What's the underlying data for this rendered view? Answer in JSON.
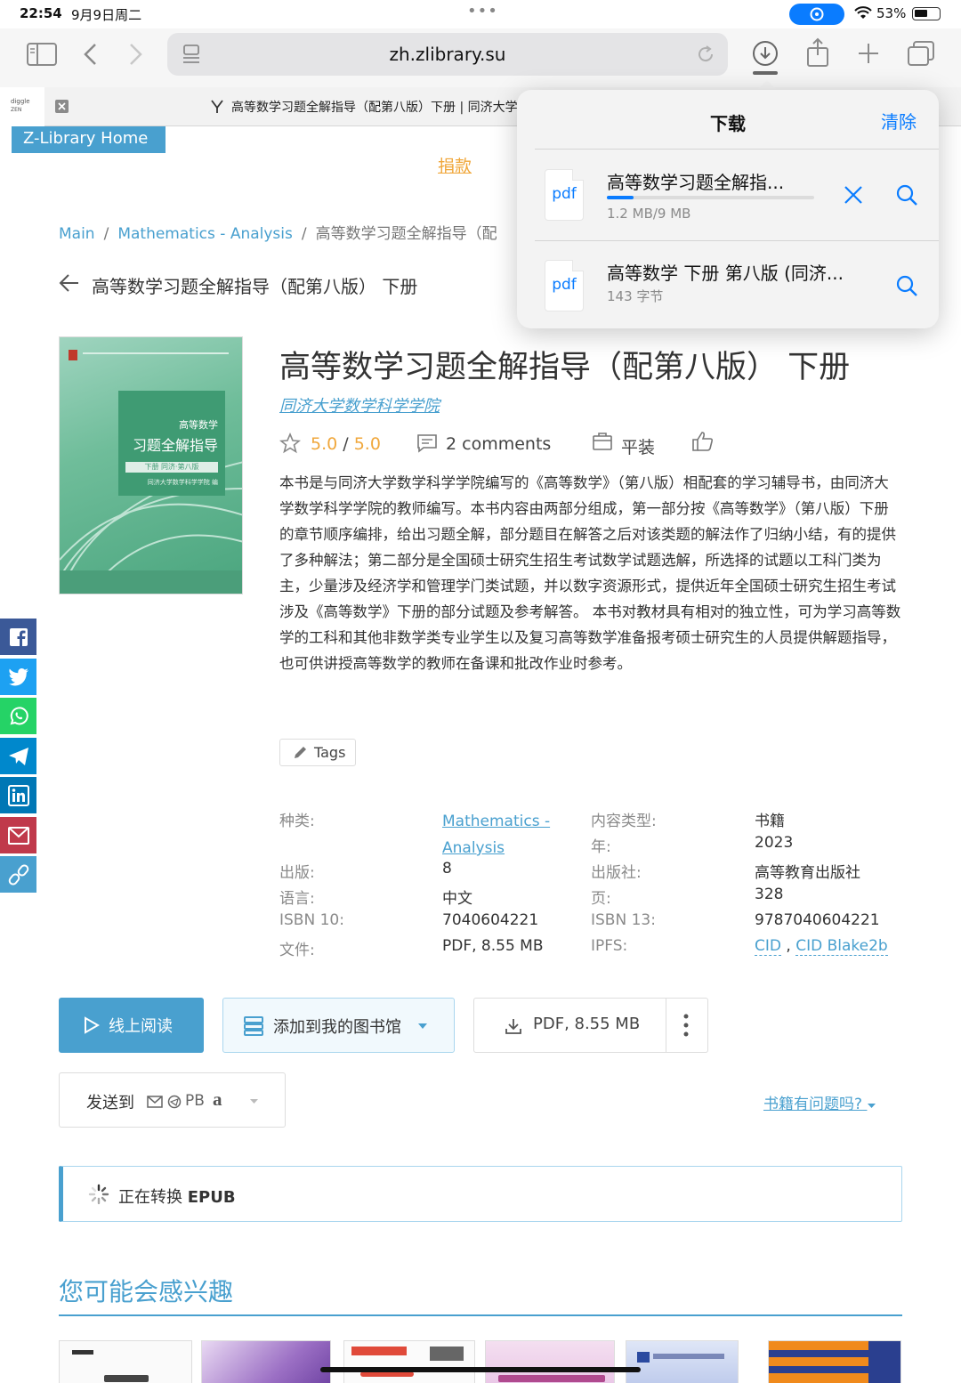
{
  "status_bar": {
    "time": "22:54",
    "date": "9月9日周二",
    "battery": "53%"
  },
  "browser": {
    "url": "zh.zlibrary.su",
    "tab_title": "高等数学习题全解指导（配第八版）下册 | 同济大学数学..."
  },
  "page": {
    "home_link": "Z-Library Home",
    "donate": "捐款",
    "breadcrumb": {
      "main": "Main",
      "category": "Mathematics - Analysis",
      "current": "高等数学习题全解指导（配"
    },
    "back_title": "高等数学习题全解指导（配第八版） 下册"
  },
  "book": {
    "title": "高等数学习题全解指导（配第八版） 下册",
    "author": "同济大学数学科学学院",
    "rating": "5.0",
    "rating_max": "5.0",
    "comments": "2 comments",
    "binding": "平装",
    "description": "本书是与同济大学数学科学学院编写的《高等数学》（第八版）相配套的学习辅导书，由同济大学数学科学学院的教师编写。本书内容由两部分组成，第一部分按《高等数学》（第八版）下册的章节顺序编排，给出习题全解，部分题目在解答之后对该类题的解法作了归纳小结，有的提供了多种解法；第二部分是全国硕士研究生招生考试数学试题选解，所选择的试题以工科门类为主，少量涉及经济学和管理学门类试题，并以数字资源形式，提供近年全国硕士研究生招生考试涉及《高等数学》下册的部分试题及参考解答。 本书对教材具有相对的独立性，可为学习高等数学的工科和其他非数学类专业学生以及复习高等数学准备报考硕士研究生的人员提供解题指导，也可供讲授高等数学的教师在备课和批改作业时参考。",
    "tags_label": "Tags",
    "cover": {
      "line1": "高等数学",
      "line2": "习题全解指导",
      "line3": "下册 同济·第八版",
      "line4": "同济大学数学科学学院 编"
    }
  },
  "details": {
    "category_label": "种类:",
    "category_value": "Mathematics - Analysis",
    "content_type_label": "内容类型:",
    "content_type_value": "书籍",
    "year_label": "年:",
    "year_value": "2023",
    "edition_label": "出版:",
    "edition_value": "8",
    "publisher_label": "出版社:",
    "publisher_value": "高等教育出版社",
    "language_label": "语言:",
    "language_value": "中文",
    "pages_label": "页:",
    "pages_value": "328",
    "isbn10_label": "ISBN 10:",
    "isbn10_value": "7040604221",
    "isbn13_label": "ISBN 13:",
    "isbn13_value": "9787040604221",
    "file_label": "文件:",
    "file_value": "PDF, 8.55 MB",
    "ipfs_label": "IPFS:",
    "ipfs_cid": "CID",
    "ipfs_sep": ",",
    "ipfs_blake": "CID Blake2b"
  },
  "actions": {
    "read_online": "线上阅读",
    "add_library": "添加到我的图书馆",
    "download": "PDF, 8.55 MB",
    "send_to": "发送到",
    "send_pb": "PB",
    "send_amazon": "a",
    "issue": "书籍有问题吗?"
  },
  "converting": {
    "prefix": "正在转换",
    "format": "EPUB"
  },
  "interest_title": "您可能会感兴趣",
  "downloads_popover": {
    "title": "下载",
    "clear": "清除",
    "items": [
      {
        "icon_label": "pdf",
        "name": "高等数学习题全解指...",
        "progress_text": "1.2 MB/9 MB",
        "progress": 0.13
      },
      {
        "icon_label": "pdf",
        "name": "高等数学 下册 第八版 (同济...",
        "size_text": "143 字节"
      }
    ]
  },
  "colors": {
    "accent": "#49a0cf",
    "ios_blue": "#0a7cff",
    "orange": "#f0a73b"
  }
}
